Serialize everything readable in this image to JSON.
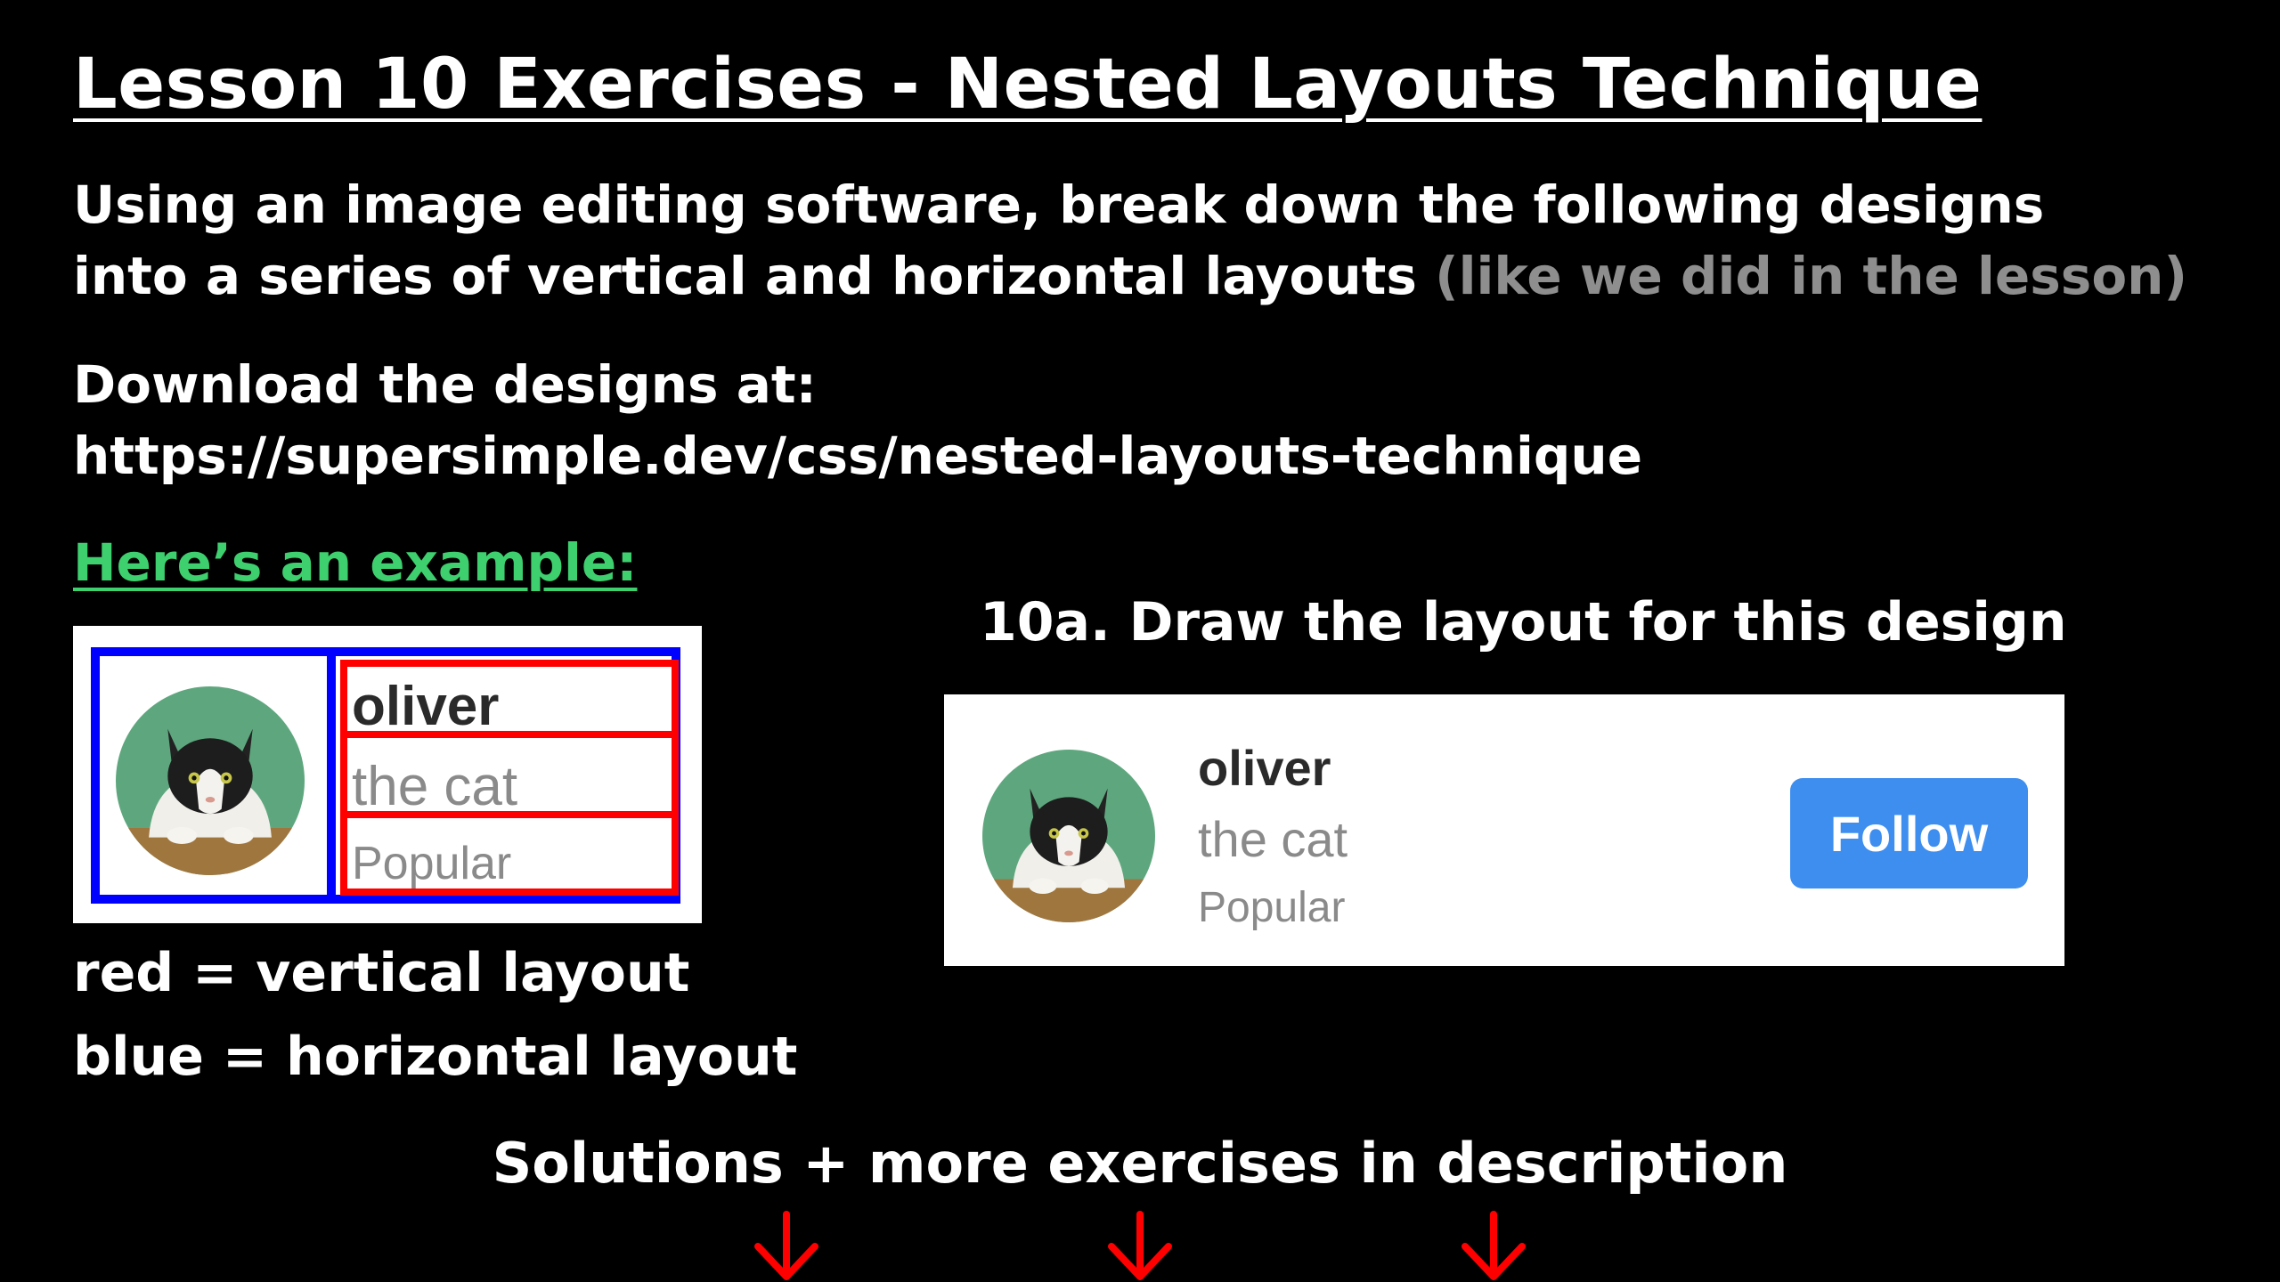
{
  "title": "Lesson 10 Exercises - Nested Layouts Technique",
  "instructions": {
    "line1": "Using an image editing software, break down the following designs",
    "line2_main": "into a series of vertical and horizontal layouts ",
    "line2_muted": "(like we did in the lesson)"
  },
  "download": {
    "label": "Download the designs at:",
    "url": "https://supersimple.dev/css/nested-layouts-technique"
  },
  "example": {
    "heading": "Here’s an example:",
    "card": {
      "name": "oliver",
      "subtitle": "the cat",
      "tag": "Popular"
    },
    "legend_red": "red = vertical layout",
    "legend_blue": "blue = horizontal layout"
  },
  "exercise": {
    "label": "10a. Draw the layout for this design",
    "card": {
      "name": "oliver",
      "subtitle": "the cat",
      "tag": "Popular",
      "button_label": "Follow"
    }
  },
  "footer": {
    "solutions": "Solutions + more exercises in description"
  },
  "colors": {
    "background": "#000000",
    "green_heading": "#3ecf6e",
    "vertical_layout": "#ff0000",
    "horizontal_layout": "#0000ff",
    "follow_button": "#3e8ef0",
    "arrow": "#ff0000"
  },
  "icons": [
    "cat-avatar-icon",
    "down-arrow-icon"
  ]
}
